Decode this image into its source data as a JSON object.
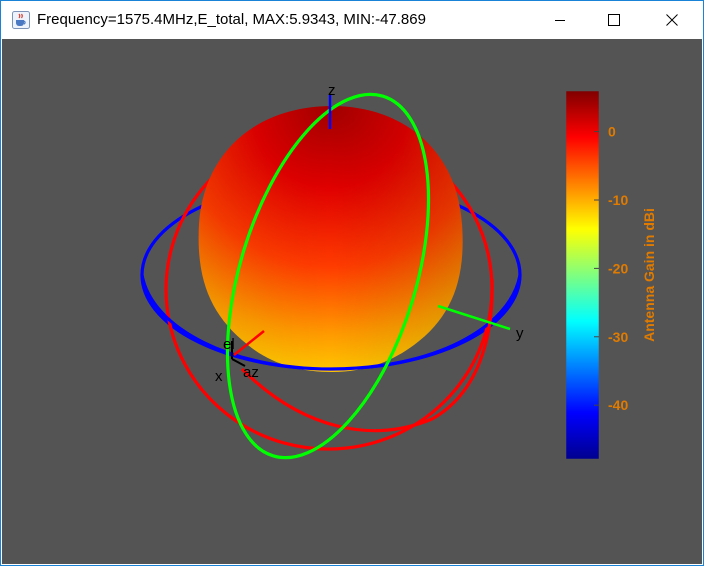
{
  "window": {
    "title": "Frequency=1575.4MHz,E_total, MAX:5.9343, MIN:-47.869",
    "icon": "java-cup-icon"
  },
  "controls": {
    "minimize_icon": "minimize-icon",
    "maximize_icon": "maximize-icon",
    "close_icon": "close-icon"
  },
  "plot": {
    "background": "#545454",
    "axes": {
      "x": "x",
      "y": "y",
      "z": "z",
      "az": "az",
      "el": "el"
    },
    "rings": {
      "azimuth_color": "#0000ff",
      "elevation_xz_color": "#ff0000",
      "elevation_yz_color": "#00ff00"
    }
  },
  "colorbar": {
    "label": "Antenna Gain in dBi",
    "min": -47.869,
    "max": 5.9343,
    "ticks": [
      0,
      -10,
      -20,
      -30,
      -40
    ],
    "tick_labels": [
      "0",
      "-10",
      "-20",
      "-30",
      "-40"
    ],
    "text_color": "#e07b00",
    "colormap": "jet"
  }
}
